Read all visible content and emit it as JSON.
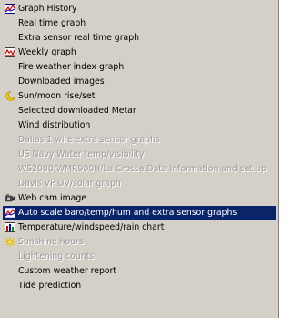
{
  "menu": {
    "items": [
      {
        "label": "Graph History",
        "icon": "graph-history-icon",
        "state": "normal"
      },
      {
        "label": "Real time graph",
        "icon": "",
        "state": "normal"
      },
      {
        "label": "Extra sensor real time graph",
        "icon": "",
        "state": "normal"
      },
      {
        "label": "Weekly graph",
        "icon": "weekly-graph-icon",
        "state": "normal"
      },
      {
        "label": "Fire weather index graph",
        "icon": "",
        "state": "normal"
      },
      {
        "label": "Downloaded images",
        "icon": "",
        "state": "normal"
      },
      {
        "label": "Sun/moon rise/set",
        "icon": "moon-icon",
        "state": "normal"
      },
      {
        "label": "Selected downloaded Metar",
        "icon": "",
        "state": "normal"
      },
      {
        "label": "Wind distribution",
        "icon": "",
        "state": "normal"
      },
      {
        "label": "Dallas 1 wire extra sensor graphs",
        "icon": "",
        "state": "disabled"
      },
      {
        "label": "US Navy Water temp/visibility",
        "icon": "",
        "state": "disabled"
      },
      {
        "label": "WS2000/WMR900H/La Crosse Data Information and set up",
        "icon": "",
        "state": "disabled"
      },
      {
        "label": "Davis VP UV/solar graph",
        "icon": "",
        "state": "disabled"
      },
      {
        "label": "Web cam image",
        "icon": "webcam-icon",
        "state": "normal"
      },
      {
        "label": "Auto scale baro/temp/hum and extra sensor graphs",
        "icon": "auto-scale-graph-icon",
        "state": "highlighted"
      },
      {
        "label": "Temperature/windspeed/rain chart",
        "icon": "bar-chart-icon",
        "state": "normal"
      },
      {
        "label": "Sunshine hours",
        "icon": "sun-icon",
        "state": "disabled"
      },
      {
        "label": "Lightening counts",
        "icon": "",
        "state": "disabled"
      },
      {
        "label": "Custom weather report",
        "icon": "",
        "state": "normal"
      },
      {
        "label": "Tide prediction",
        "icon": "",
        "state": "normal"
      }
    ]
  },
  "colors": {
    "menu_background": "#d4d0c8",
    "highlight_background": "#0a246a",
    "highlight_text": "#ffffff",
    "disabled_text": "#9c9c9c"
  }
}
